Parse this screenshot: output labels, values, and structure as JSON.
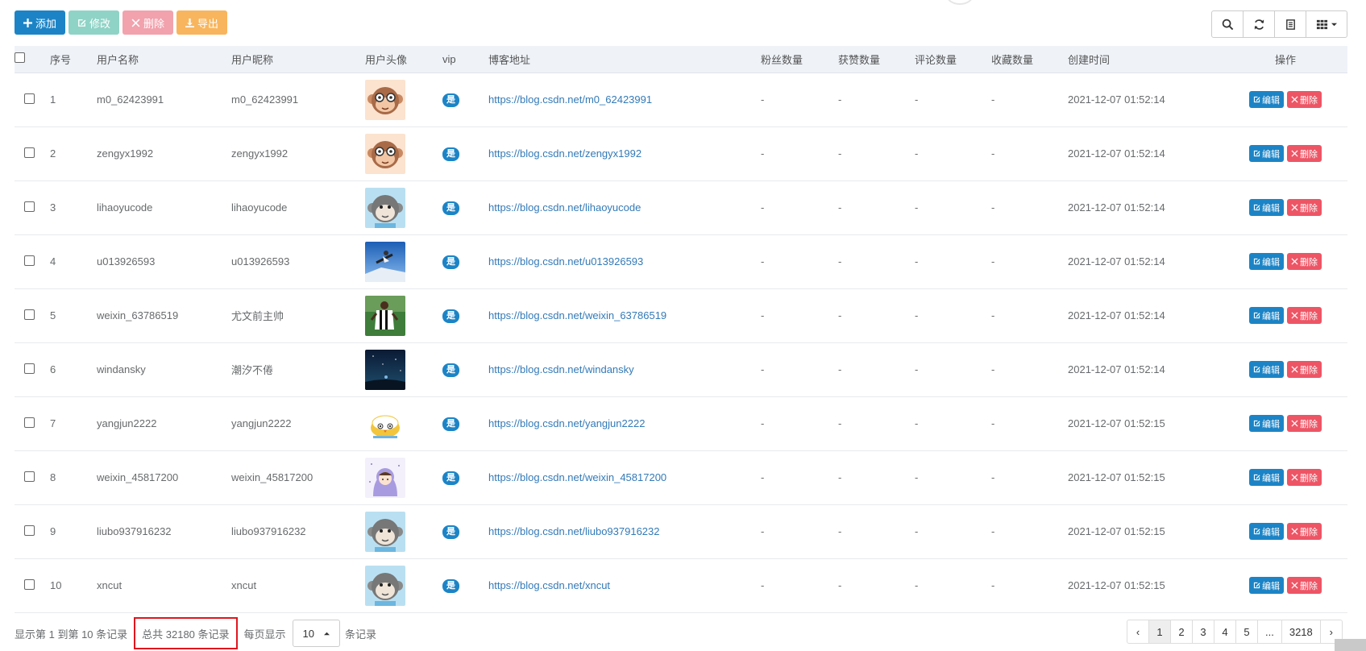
{
  "toolbar": {
    "add_label": "添加",
    "edit_label": "修改",
    "delete_label": "删除",
    "export_label": "导出"
  },
  "tools": [
    "search-icon",
    "refresh-icon",
    "toggle-view-icon",
    "columns-icon"
  ],
  "table": {
    "headers": {
      "id": "序号",
      "username": "用户名称",
      "nickname": "用户昵称",
      "avatar": "用户头像",
      "vip": "vip",
      "blog": "博客地址",
      "fans": "粉丝数量",
      "likes": "获赞数量",
      "comments": "评论数量",
      "favorites": "收藏数量",
      "created": "创建时间",
      "ops": "操作"
    },
    "edit_label": "编辑",
    "delete_label": "删除",
    "rows": [
      {
        "id": "1",
        "username": "m0_62423991",
        "nickname": "m0_62423991",
        "vip": "是",
        "blog": "https://blog.csdn.net/m0_62423991",
        "fans": "-",
        "likes": "-",
        "comments": "-",
        "favorites": "-",
        "created": "2021-12-07 01:52:14",
        "avatar": "monkey-glasses"
      },
      {
        "id": "2",
        "username": "zengyx1992",
        "nickname": "zengyx1992",
        "vip": "是",
        "blog": "https://blog.csdn.net/zengyx1992",
        "fans": "-",
        "likes": "-",
        "comments": "-",
        "favorites": "-",
        "created": "2021-12-07 01:52:14",
        "avatar": "monkey-glasses"
      },
      {
        "id": "3",
        "username": "lihaoyucode",
        "nickname": "lihaoyucode",
        "vip": "是",
        "blog": "https://blog.csdn.net/lihaoyucode",
        "fans": "-",
        "likes": "-",
        "comments": "-",
        "favorites": "-",
        "created": "2021-12-07 01:52:14",
        "avatar": "monkey-blue"
      },
      {
        "id": "4",
        "username": "u013926593",
        "nickname": "u013926593",
        "vip": "是",
        "blog": "https://blog.csdn.net/u013926593",
        "fans": "-",
        "likes": "-",
        "comments": "-",
        "favorites": "-",
        "created": "2021-12-07 01:52:14",
        "avatar": "snowboarder-photo"
      },
      {
        "id": "5",
        "username": "weixin_63786519",
        "nickname": "尤文前主帅",
        "vip": "是",
        "blog": "https://blog.csdn.net/weixin_63786519",
        "fans": "-",
        "likes": "-",
        "comments": "-",
        "favorites": "-",
        "created": "2021-12-07 01:52:14",
        "avatar": "football-photo"
      },
      {
        "id": "6",
        "username": "windansky",
        "nickname": "潮汐不倦",
        "vip": "是",
        "blog": "https://blog.csdn.net/windansky",
        "fans": "-",
        "likes": "-",
        "comments": "-",
        "favorites": "-",
        "created": "2021-12-07 01:52:14",
        "avatar": "night-sky-photo"
      },
      {
        "id": "7",
        "username": "yangjun2222",
        "nickname": "yangjun2222",
        "vip": "是",
        "blog": "https://blog.csdn.net/yangjun2222",
        "fans": "-",
        "likes": "-",
        "comments": "-",
        "favorites": "-",
        "created": "2021-12-07 01:52:15",
        "avatar": "bird-cartoon"
      },
      {
        "id": "8",
        "username": "weixin_45817200",
        "nickname": "weixin_45817200",
        "vip": "是",
        "blog": "https://blog.csdn.net/weixin_45817200",
        "fans": "-",
        "likes": "-",
        "comments": "-",
        "favorites": "-",
        "created": "2021-12-07 01:52:15",
        "avatar": "hoodie-cartoon"
      },
      {
        "id": "9",
        "username": "liubo937916232",
        "nickname": "liubo937916232",
        "vip": "是",
        "blog": "https://blog.csdn.net/liubo937916232",
        "fans": "-",
        "likes": "-",
        "comments": "-",
        "favorites": "-",
        "created": "2021-12-07 01:52:15",
        "avatar": "monkey-blue"
      },
      {
        "id": "10",
        "username": "xncut",
        "nickname": "xncut",
        "vip": "是",
        "blog": "https://blog.csdn.net/xncut",
        "fans": "-",
        "likes": "-",
        "comments": "-",
        "favorites": "-",
        "created": "2021-12-07 01:52:15",
        "avatar": "monkey-blue"
      }
    ]
  },
  "footer": {
    "showing": "显示第 1 到第 10 条记录",
    "total": "总共 32180 条记录",
    "per_page_prefix": "每页显示",
    "page_size": "10",
    "per_page_suffix": "条记录"
  },
  "pagination": {
    "prev": "‹",
    "pages": [
      "1",
      "2",
      "3",
      "4",
      "5",
      "...",
      "3218"
    ],
    "active": "1",
    "next": "›"
  },
  "colors": {
    "primary": "#1c84c6",
    "danger": "#ed5565",
    "success_light": "#8fd3c6",
    "warning": "#f8b55d",
    "highlight": "#e0161f"
  }
}
